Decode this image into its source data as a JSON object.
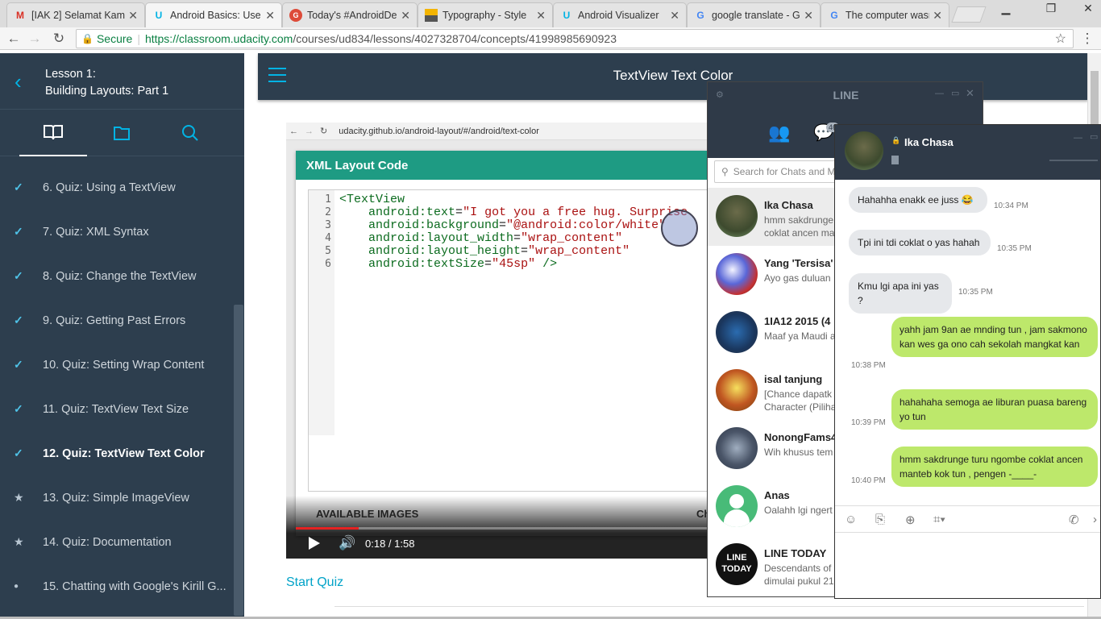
{
  "browser": {
    "tabs": [
      {
        "label": "[IAK 2] Selamat Kam",
        "icon": "gmail-icon"
      },
      {
        "label": "Android Basics: Use",
        "icon": "udacity-icon"
      },
      {
        "label": "Today's #AndroidDe",
        "icon": "googleplus-icon"
      },
      {
        "label": "Typography - Style",
        "icon": "material-icon"
      },
      {
        "label": "Android Visualizer",
        "icon": "udacity-icon"
      },
      {
        "label": "google translate - G",
        "icon": "google-icon"
      },
      {
        "label": "The computer wasn",
        "icon": "google-icon"
      }
    ],
    "secure_label": "Secure",
    "url_host": "https://classroom.udacity.com",
    "url_path": "/courses/ud834/lessons/4027328704/concepts/41998985690923"
  },
  "sidebar": {
    "lesson_label": "Lesson 1:",
    "lesson_title": "Building Layouts: Part 1",
    "items": [
      {
        "label": "6. Quiz: Using a TextView",
        "status": "done"
      },
      {
        "label": "7. Quiz: XML Syntax",
        "status": "done"
      },
      {
        "label": "8. Quiz: Change the TextView",
        "status": "done"
      },
      {
        "label": "9. Quiz: Getting Past Errors",
        "status": "done"
      },
      {
        "label": "10. Quiz: Setting Wrap Content",
        "status": "done"
      },
      {
        "label": "11. Quiz: TextView Text Size",
        "status": "done"
      },
      {
        "label": "12. Quiz: TextView Text Color",
        "status": "current"
      },
      {
        "label": "13. Quiz: Simple ImageView",
        "status": "star"
      },
      {
        "label": "14. Quiz: Documentation",
        "status": "star"
      },
      {
        "label": "15. Chatting with Google's Kirill G...",
        "status": "dot"
      }
    ]
  },
  "header": {
    "title": "TextView Text Color"
  },
  "video": {
    "inner_url": "udacity.github.io/android-layout/#/android/text-color",
    "panel_title": "XML Layout Code",
    "code_lines": [
      "1",
      "2",
      "3",
      "4",
      "5",
      "6"
    ],
    "available_images": "AVAILABLE IMAGES",
    "cut_label": "Ch",
    "time": "0:18 / 1:58",
    "progress": 0.153
  },
  "start_quiz": "Start Quiz",
  "line": {
    "title": "LINE",
    "badge": "46",
    "search_placeholder": "Search for Chats and M",
    "chats": [
      {
        "name": "Ika Chasa",
        "preview1": "hmm sakdrunge",
        "preview2": "coklat ancen ma"
      },
      {
        "name": "Yang 'Tersisa' :",
        "preview1": "Ayo gas duluan",
        "preview2": ""
      },
      {
        "name": "1IA12 2015 (4",
        "preview1": "Maaf ya Maudi a",
        "preview2": ""
      },
      {
        "name": "isal tanjung",
        "preview1": "[Chance dapatk",
        "preview2": "Character (Piliha"
      },
      {
        "name": "NonongFams4",
        "preview1": "Wih khusus tem",
        "preview2": ""
      },
      {
        "name": "Anas",
        "preview1": "Oalahh lgi ngert",
        "preview2": ""
      },
      {
        "name": "LINE TODAY",
        "preview1": "Descendants of",
        "preview2": "dimulai pukul 21"
      }
    ],
    "line_today_logo": "LINE TODAY",
    "chat": {
      "name": "Ika Chasa",
      "messages": [
        {
          "dir": "in",
          "text": "Hahahha enakk ee juss 😂",
          "time": "10:34 PM"
        },
        {
          "dir": "in",
          "text": "Tpi ini tdi coklat o yas hahah",
          "time": "10:35 PM"
        },
        {
          "dir": "in",
          "text": "Kmu lgi apa ini yas ?",
          "time": "10:35 PM"
        },
        {
          "dir": "out",
          "text": "yahh jam 9an ae mnding tun , jam sakmono kan wes ga ono cah sekolah mangkat kan",
          "time": "10:38 PM"
        },
        {
          "dir": "out",
          "text": "hahahaha semoga ae liburan puasa bareng yo tun",
          "time": "10:39 PM"
        },
        {
          "dir": "out",
          "text": "hmm sakdrunge turu ngombe coklat ancen manteb kok tun , pengen -____-",
          "time": "10:40 PM"
        }
      ]
    }
  }
}
